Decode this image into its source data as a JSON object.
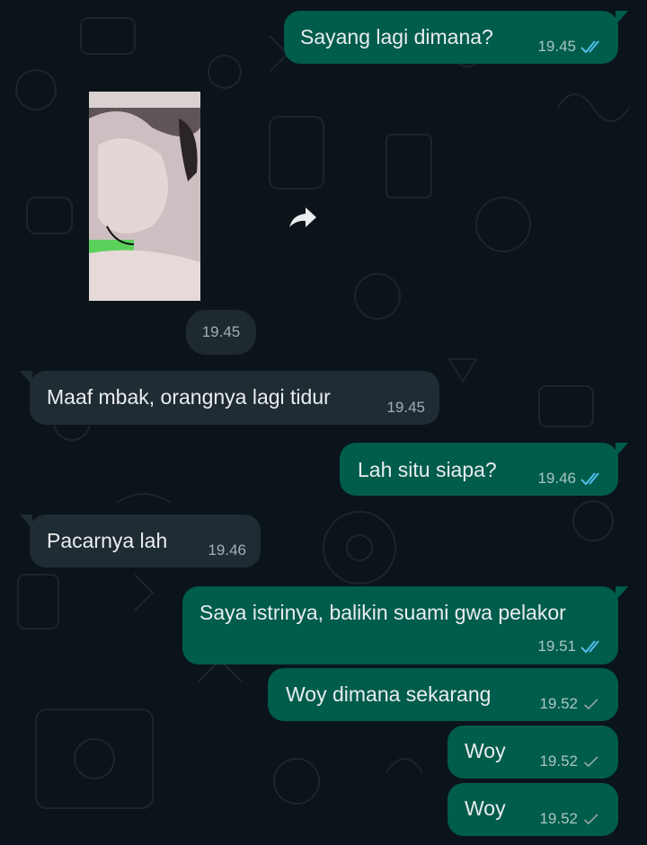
{
  "colors": {
    "background": "#0b141a",
    "outgoing_bubble": "#005c4b",
    "incoming_bubble": "#202c33",
    "read_tick": "#53bdeb",
    "sent_tick": "#8fa6a1"
  },
  "photo_message": {
    "time": "19.45",
    "forward_icon": "forward-icon"
  },
  "messages": [
    {
      "direction": "outgoing",
      "text": "Sayang lagi dimana?",
      "time": "19.45",
      "status": "read"
    },
    {
      "direction": "incoming",
      "text": "Maaf mbak, orangnya lagi tidur",
      "time": "19.45"
    },
    {
      "direction": "outgoing",
      "text": "Lah situ siapa?",
      "time": "19.46",
      "status": "read"
    },
    {
      "direction": "incoming",
      "text": "Pacarnya lah",
      "time": "19.46"
    },
    {
      "direction": "outgoing",
      "text": "Saya istrinya, balikin suami gwa pelakor",
      "time": "19.51",
      "status": "read"
    },
    {
      "direction": "outgoing",
      "text": "Woy dimana sekarang",
      "time": "19.52",
      "status": "sent"
    },
    {
      "direction": "outgoing",
      "text": "Woy",
      "time": "19.52",
      "status": "sent"
    },
    {
      "direction": "outgoing",
      "text": "Woy",
      "time": "19.52",
      "status": "sent"
    }
  ]
}
